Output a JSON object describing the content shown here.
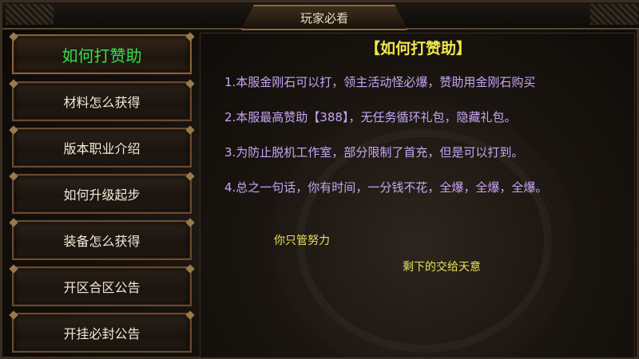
{
  "header": {
    "title": "玩家必看"
  },
  "sidebar": {
    "items": [
      {
        "label": "如何打赞助"
      },
      {
        "label": "材料怎么获得"
      },
      {
        "label": "版本职业介绍"
      },
      {
        "label": "如何升级起步"
      },
      {
        "label": "装备怎么获得"
      },
      {
        "label": "开区合区公告"
      },
      {
        "label": "开挂必封公告"
      }
    ]
  },
  "content": {
    "title": "【如何打赞助】",
    "rules": [
      "1.本服金刚石可以打，领主活动怪必爆，赞助用金刚石购买",
      "2.本服最高赞助【388】，无任务循环礼包，隐藏礼包。",
      "3.为防止脱机工作室，部分限制了首充，但是可以打到。",
      "4.总之一句话，你有时间，一分钱不花，全爆，全爆，全爆。"
    ],
    "slogan_1": "你只管努力",
    "slogan_2": "剩下的交给天意"
  },
  "colors": {
    "active_menu": "#36e04a",
    "title_yellow": "#f0e64a",
    "rule_purple": "#c7a6f4",
    "slogan_yellow": "#e8e05a",
    "frame_bronze": "#6b4a2e"
  }
}
